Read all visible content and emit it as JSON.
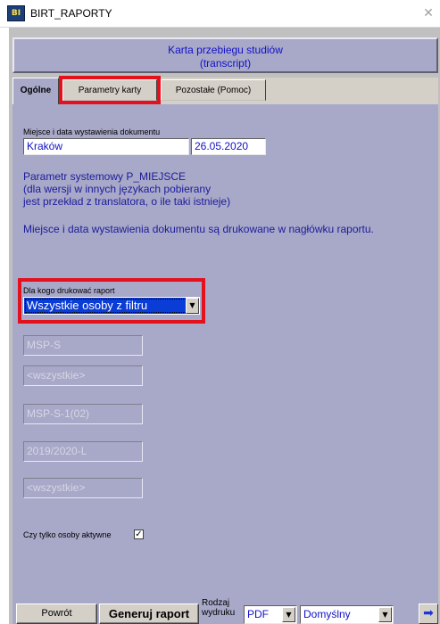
{
  "window": {
    "title": "BIRT_RAPORTY",
    "app_icon": "birt-app-icon",
    "close_glyph": "✕"
  },
  "header": {
    "line1": "Karta przebiegu studiów",
    "line2": "(transcript)"
  },
  "tabs": [
    {
      "label": "Ogólne",
      "active": true,
      "highlighted": false
    },
    {
      "label": "Parametry karty",
      "active": false,
      "highlighted": true
    },
    {
      "label": "Pozostałe (Pomoc)",
      "active": false,
      "highlighted": false
    }
  ],
  "location_date": {
    "label": "Miejsce i data wystawienia dokumentu",
    "place": "Kraków",
    "date": "26.05.2020"
  },
  "info": {
    "line1": "Parametr systemowy P_MIEJSCE",
    "line2": "(dla wersji w innych językach pobierany",
    "line3": "jest przekład z translatora, o ile taki istnieje)",
    "line4": "Miejsce i data wystawienia dokumentu są drukowane w nagłówku raportu."
  },
  "print_for": {
    "label": "Dla kogo drukować raport",
    "selected": "Wszystkie osoby z filtru",
    "arrow": "▼"
  },
  "filters": [
    "MSP-S",
    "<wszystkie>",
    "MSP-S-1(02)",
    "2019/2020-L",
    "<wszystkie>"
  ],
  "active_only": {
    "label": "Czy tylko osoby aktywne",
    "checked": true,
    "check_glyph": "✓"
  },
  "footer": {
    "back_label": "Powrót",
    "generate_label": "Generuj raport",
    "output_type_label_1": "Rodzaj",
    "output_type_label_2": "wydruku",
    "format_value": "PDF",
    "template_value": "Domyślny",
    "arrow": "▼",
    "go_glyph": "➡"
  },
  "colors": {
    "panel": "#a8a8c8",
    "highlight": "#e4101c",
    "text_blue": "#1212c8",
    "selection": "#0a3cd6"
  }
}
